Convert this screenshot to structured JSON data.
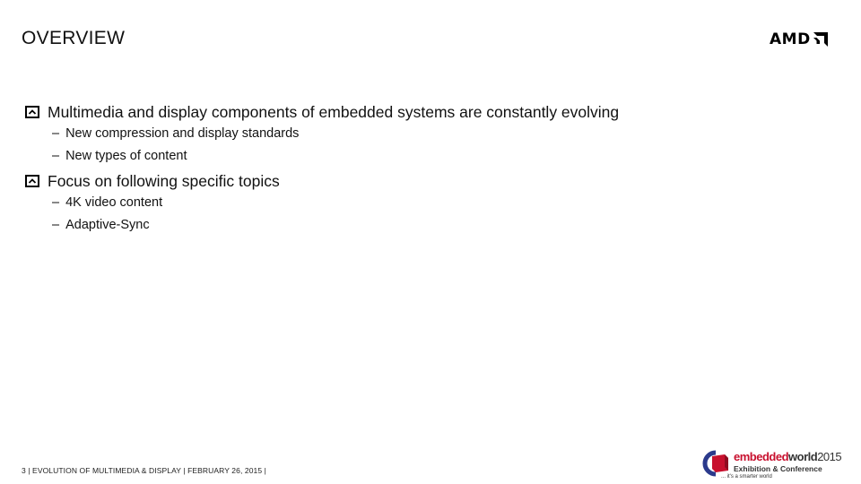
{
  "slide": {
    "title": "OVERVIEW",
    "bullets": [
      {
        "text": "Multimedia and display components of embedded systems are constantly evolving",
        "sub": [
          "New compression and display standards",
          "New types of content"
        ]
      },
      {
        "text": "Focus on following specific topics",
        "sub": [
          "4K video content",
          "Adaptive-Sync"
        ]
      }
    ],
    "sub_marker": "–"
  },
  "brand": {
    "amd_wordmark": "AMD",
    "amd_icon": "amd-arrow-icon"
  },
  "footer": {
    "text": "3   | EVOLUTION OF MULTIMEDIA & DISPLAY | FEBRUARY 26, 2015 |"
  },
  "event_logo": {
    "name_part1": "embedded",
    "name_part2": "world",
    "year": "2015",
    "subtitle": "Exhibition & Conference",
    "tagline": "... it's a smarter world",
    "accent_color": "#c8102e"
  }
}
